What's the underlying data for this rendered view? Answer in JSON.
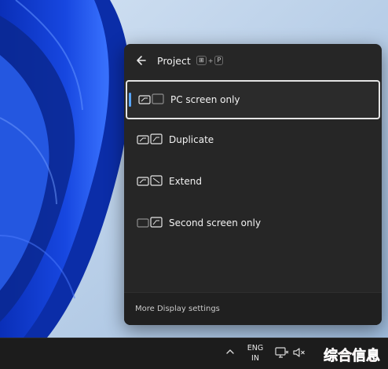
{
  "panel": {
    "title": "Project",
    "shortcut": {
      "key1": "⊞",
      "plus": "+",
      "key2": "P"
    },
    "options": [
      {
        "label": "PC screen only",
        "icon": "pc-screen-only-icon",
        "selected": true
      },
      {
        "label": "Duplicate",
        "icon": "duplicate-icon",
        "selected": false
      },
      {
        "label": "Extend",
        "icon": "extend-icon",
        "selected": false
      },
      {
        "label": "Second screen only",
        "icon": "second-screen-only-icon",
        "selected": false
      }
    ],
    "footer_link": "More Display settings"
  },
  "taskbar": {
    "language": {
      "line1": "ENG",
      "line2": "IN"
    }
  },
  "watermark": {
    "text": "综合信息"
  },
  "colors": {
    "accent": "#58a6ff",
    "panel_bg": "#262626",
    "taskbar_bg": "#1c1c1c"
  }
}
